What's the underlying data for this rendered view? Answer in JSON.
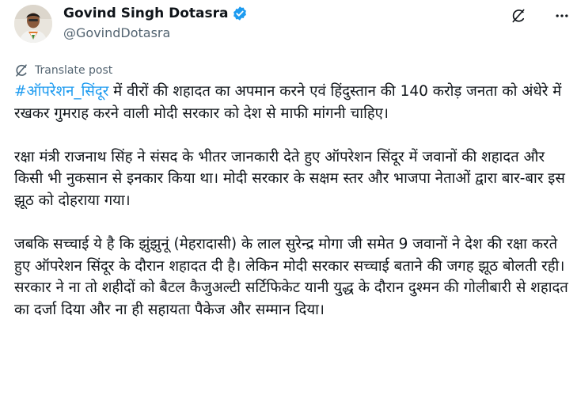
{
  "author": {
    "name": "Govind Singh Dotasra",
    "handle": "@GovindDotasra",
    "verified": true
  },
  "icons": {
    "verified": "verified-badge-icon",
    "grok": "grok-icon",
    "more": "more-icon",
    "translate": "translate-icon"
  },
  "colors": {
    "link": "#1d9bf0",
    "text": "#0f1419",
    "muted": "#536471"
  },
  "translate_label": "Translate post",
  "post": {
    "hashtag": "#ऑपरेशन_सिंदूर",
    "p1_rest": " में वीरों की शहादत का अपमान करने एवं हिंदुस्तान की 140 करोड़ जनता को अंधेरे में रखकर गुमराह करने वाली मोदी सरकार को देश से माफी मांगनी चाहिए।",
    "p2": "रक्षा मंत्री राजनाथ सिंह ने संसद के भीतर जानकारी देते हुए ऑपरेशन सिंदूर में जवानों की शहादत और किसी भी नुकसान से इनकार किया था। मोदी सरकार के सक्षम स्तर और भाजपा नेताओं द्वारा बार-बार इस झूठ को दोहराया गया।",
    "p3": "जबकि सच्चाई ये है कि झुंझुनूं (मेहरादासी) के लाल सुरेन्द्र मोगा जी समेत 9 जवानों ने देश की रक्षा करते हुए ऑपरेशन सिंदूर के दौरान शहादत दी है। लेकिन मोदी सरकार सच्चाई बताने की जगह झूठ बोलती रही। सरकार ने ना तो शहीदों को बैटल कैजुअल्टी सर्टिफिकेट यानी युद्ध के दौरान दुश्मन की गोलीबारी से शहादत का दर्जा दिया और ना ही सहायता पैकेज और सम्मान दिया।"
  }
}
